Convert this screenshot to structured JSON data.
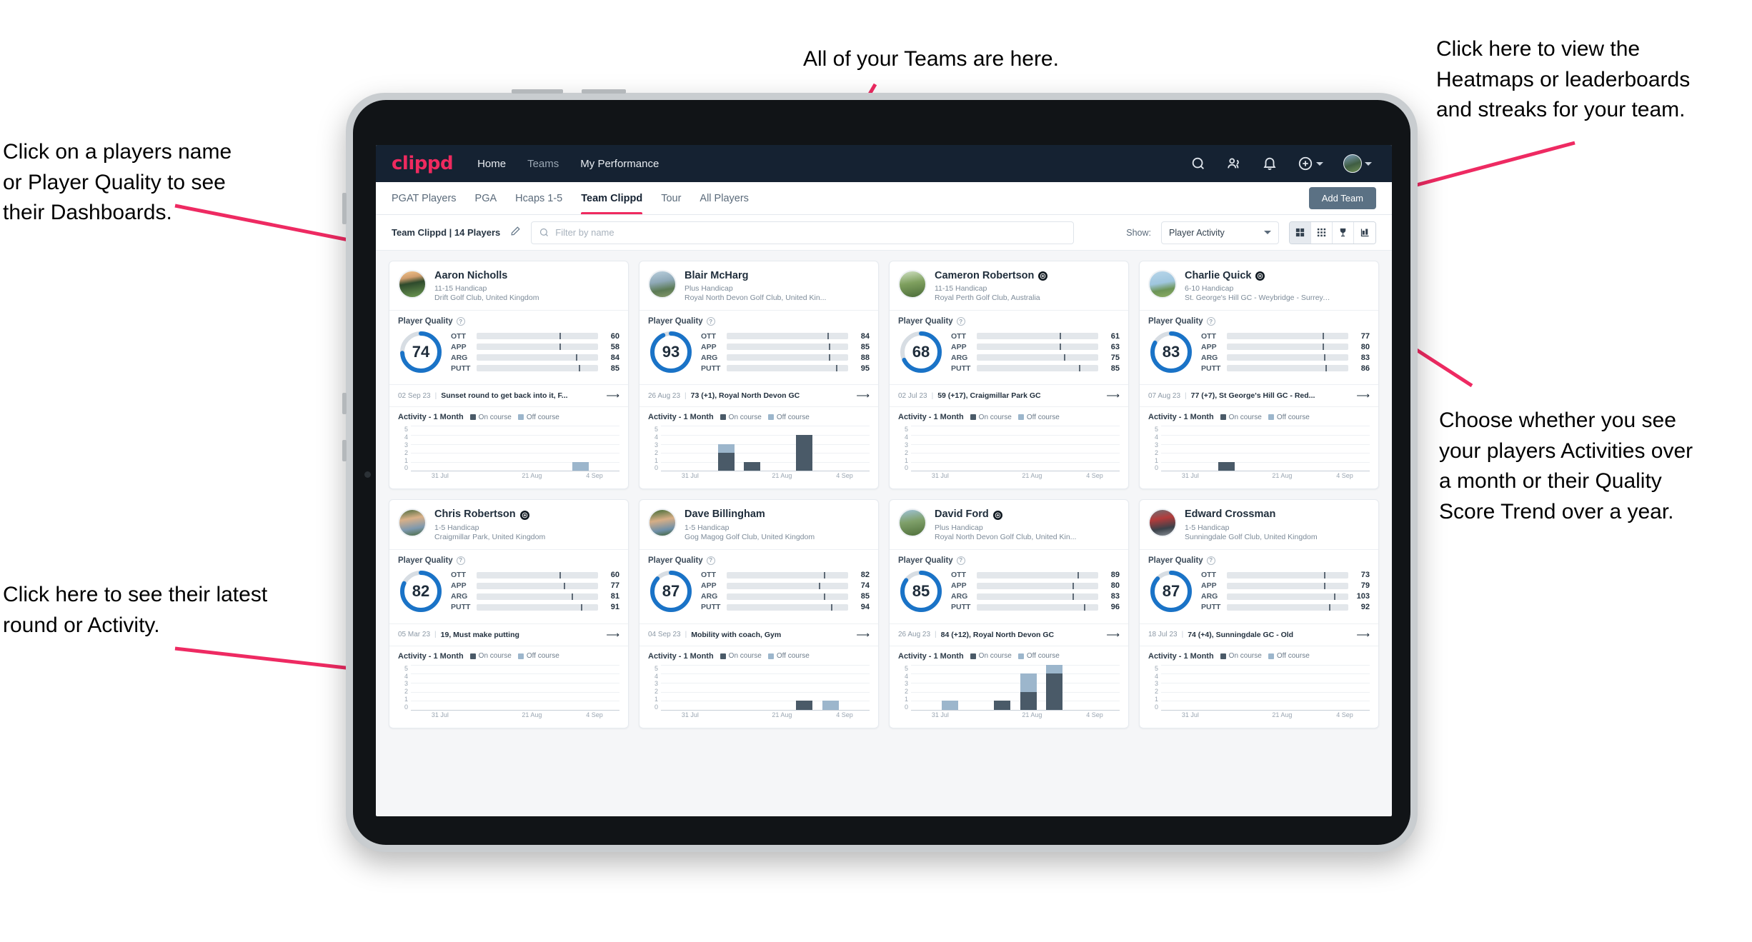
{
  "annotations": [
    {
      "id": "teams",
      "text": "All of your Teams are here."
    },
    {
      "id": "heatmaps",
      "text": "Click here to view the\nHeatmaps or leaderboards\nand streaks for your team."
    },
    {
      "id": "players-name",
      "text": "Click on a players name\nor Player Quality to see\ntheir Dashboards."
    },
    {
      "id": "activity-choice",
      "text": "Choose whether you see\nyour players Activities over\na month or their Quality\nScore Trend over a year."
    },
    {
      "id": "latest-round",
      "text": "Click here to see their latest\nround or Activity."
    }
  ],
  "topnav": {
    "logo": "clippd",
    "links": [
      {
        "label": "Home",
        "active": true
      },
      {
        "label": "Teams",
        "active": false
      },
      {
        "label": "My Performance",
        "active": false
      }
    ],
    "icons": [
      "search-icon",
      "people-icon",
      "bell-icon",
      "plus-circle-icon",
      "avatar"
    ]
  },
  "tabs": [
    {
      "label": "PGAT Players",
      "active": false
    },
    {
      "label": "PGA",
      "active": false
    },
    {
      "label": "Hcaps 1-5",
      "active": false
    },
    {
      "label": "Team Clippd",
      "active": true
    },
    {
      "label": "Tour",
      "active": false
    },
    {
      "label": "All Players",
      "active": false
    }
  ],
  "add_team_label": "Add Team",
  "toolbar": {
    "team_label": "Team Clippd | 14 Players",
    "edit_icon": "pencil-icon",
    "search_placeholder": "Filter by name",
    "search_value": "",
    "show_label": "Show:",
    "show_value": "Player Activity",
    "views": [
      {
        "name": "grid-large-view",
        "active": true
      },
      {
        "name": "grid-small-view",
        "active": false
      },
      {
        "name": "trophy-view",
        "active": false
      },
      {
        "name": "stats-view",
        "active": false
      }
    ]
  },
  "card_labels": {
    "player_quality": "Player Quality",
    "activity": "Activity - 1 Month",
    "legend_on": "On course",
    "legend_off": "Off course",
    "metrics": [
      "OTT",
      "APP",
      "ARG",
      "PUTT"
    ]
  },
  "metric_colors": {
    "OTT": "#f5b400",
    "APP": "#2ecfa0",
    "ARG": "#f5124f",
    "PUTT": "#aa00cc",
    "ring": "#1a73c7",
    "ring_track": "#d7dde3"
  },
  "chart_data": {
    "type": "bar",
    "title": "Activity - 1 Month",
    "xlabel": "",
    "ylabel": "",
    "ylim": [
      0,
      5
    ],
    "yticks": [
      0,
      1,
      2,
      3,
      4,
      5
    ],
    "xticks": [
      "31 Jul",
      "21 Aug",
      "4 Sep"
    ],
    "grid": true,
    "legend": [
      "On course",
      "Off course"
    ],
    "legend_position": "top",
    "panels": [
      {
        "player": "Aaron Nicholls",
        "series": [
          {
            "name": "On course",
            "values": [
              0,
              0,
              0,
              0,
              0,
              0,
              0,
              0
            ]
          },
          {
            "name": "Off course",
            "values": [
              0,
              0,
              0,
              0,
              0,
              0,
              1,
              0
            ]
          }
        ]
      },
      {
        "player": "Blair McHarg",
        "series": [
          {
            "name": "On course",
            "values": [
              0,
              0,
              2,
              1,
              0,
              4,
              0,
              0
            ]
          },
          {
            "name": "Off course",
            "values": [
              0,
              0,
              1,
              0,
              0,
              0,
              0,
              0
            ]
          }
        ]
      },
      {
        "player": "Cameron Robertson",
        "series": [
          {
            "name": "On course",
            "values": [
              0,
              0,
              0,
              0,
              0,
              0,
              0,
              0
            ]
          },
          {
            "name": "Off course",
            "values": [
              0,
              0,
              0,
              0,
              0,
              0,
              0,
              0
            ]
          }
        ]
      },
      {
        "player": "Charlie Quick",
        "series": [
          {
            "name": "On course",
            "values": [
              0,
              0,
              1,
              0,
              0,
              0,
              0,
              0
            ]
          },
          {
            "name": "Off course",
            "values": [
              0,
              0,
              0,
              0,
              0,
              0,
              0,
              0
            ]
          }
        ]
      },
      {
        "player": "Chris Robertson",
        "series": [
          {
            "name": "On course",
            "values": [
              0,
              0,
              0,
              0,
              0,
              0,
              0,
              0
            ]
          },
          {
            "name": "Off course",
            "values": [
              0,
              0,
              0,
              0,
              0,
              0,
              0,
              0
            ]
          }
        ]
      },
      {
        "player": "Dave Billingham",
        "series": [
          {
            "name": "On course",
            "values": [
              0,
              0,
              0,
              0,
              0,
              0,
              1,
              0
            ]
          },
          {
            "name": "Off course",
            "values": [
              0,
              0,
              0,
              0,
              0,
              0,
              0,
              1
            ]
          }
        ]
      },
      {
        "player": "David Ford",
        "series": [
          {
            "name": "On course",
            "values": [
              0,
              0,
              0,
              1,
              2,
              4,
              0,
              0
            ]
          },
          {
            "name": "Off course",
            "values": [
              0,
              1,
              0,
              0,
              2,
              1,
              0,
              0
            ]
          }
        ]
      },
      {
        "player": "Edward Crossman",
        "series": [
          {
            "name": "On course",
            "values": [
              0,
              0,
              0,
              0,
              0,
              0,
              0,
              0
            ]
          },
          {
            "name": "Off course",
            "values": [
              0,
              0,
              0,
              0,
              0,
              0,
              0,
              0
            ]
          }
        ]
      }
    ]
  },
  "players": [
    {
      "name": "Aaron Nicholls",
      "verified": false,
      "handicap": "11-15 Handicap",
      "club": "Drift Golf Club, United Kingdom",
      "quality": 74,
      "metrics": [
        {
          "key": "OTT",
          "value": 60,
          "fill": 52,
          "tick": 68
        },
        {
          "key": "APP",
          "value": 58,
          "fill": 50,
          "tick": 68
        },
        {
          "key": "ARG",
          "value": 84,
          "fill": 76,
          "tick": 82
        },
        {
          "key": "PUTT",
          "value": 85,
          "fill": 78,
          "tick": 84
        }
      ],
      "round_date": "02 Sep 23",
      "round_text": "Sunset round to get back into it, F..."
    },
    {
      "name": "Blair McHarg",
      "verified": false,
      "handicap": "Plus Handicap",
      "club": "Royal North Devon Golf Club, United Kin...",
      "quality": 93,
      "metrics": [
        {
          "key": "OTT",
          "value": 84,
          "fill": 78,
          "tick": 83
        },
        {
          "key": "APP",
          "value": 85,
          "fill": 79,
          "tick": 84
        },
        {
          "key": "ARG",
          "value": 88,
          "fill": 80,
          "tick": 84
        },
        {
          "key": "PUTT",
          "value": 95,
          "fill": 86,
          "tick": 90
        }
      ],
      "round_date": "26 Aug 23",
      "round_text": "73 (+1), Royal North Devon GC"
    },
    {
      "name": "Cameron Robertson",
      "verified": true,
      "handicap": "11-15 Handicap",
      "club": "Royal Perth Golf Club, Australia",
      "quality": 68,
      "metrics": [
        {
          "key": "OTT",
          "value": 61,
          "fill": 52,
          "tick": 68
        },
        {
          "key": "APP",
          "value": 63,
          "fill": 54,
          "tick": 68
        },
        {
          "key": "ARG",
          "value": 75,
          "fill": 64,
          "tick": 72
        },
        {
          "key": "PUTT",
          "value": 85,
          "fill": 78,
          "tick": 84
        }
      ],
      "round_date": "02 Jul 23",
      "round_text": "59 (+17), Craigmillar Park GC"
    },
    {
      "name": "Charlie Quick",
      "verified": true,
      "handicap": "6-10 Handicap",
      "club": "St. George's Hill GC - Weybridge - Surrey, ...",
      "quality": 83,
      "metrics": [
        {
          "key": "OTT",
          "value": 77,
          "fill": 67,
          "tick": 79
        },
        {
          "key": "APP",
          "value": 80,
          "fill": 70,
          "tick": 79
        },
        {
          "key": "ARG",
          "value": 83,
          "fill": 72,
          "tick": 80
        },
        {
          "key": "PUTT",
          "value": 86,
          "fill": 75,
          "tick": 81
        }
      ],
      "round_date": "07 Aug 23",
      "round_text": "77 (+7), St George's Hill GC - Red..."
    },
    {
      "name": "Chris Robertson",
      "verified": true,
      "handicap": "1-5 Handicap",
      "club": "Craigmillar Park, United Kingdom",
      "quality": 82,
      "metrics": [
        {
          "key": "OTT",
          "value": 60,
          "fill": 52,
          "tick": 68
        },
        {
          "key": "APP",
          "value": 77,
          "fill": 66,
          "tick": 72
        },
        {
          "key": "ARG",
          "value": 81,
          "fill": 70,
          "tick": 78
        },
        {
          "key": "PUTT",
          "value": 91,
          "fill": 81,
          "tick": 86
        }
      ],
      "round_date": "05 Mar 23",
      "round_text": "19, Must make putting"
    },
    {
      "name": "Dave Billingham",
      "verified": false,
      "handicap": "1-5 Handicap",
      "club": "Gog Magog Golf Club, United Kingdom",
      "quality": 87,
      "metrics": [
        {
          "key": "OTT",
          "value": 82,
          "fill": 72,
          "tick": 80
        },
        {
          "key": "APP",
          "value": 74,
          "fill": 63,
          "tick": 76
        },
        {
          "key": "ARG",
          "value": 85,
          "fill": 74,
          "tick": 80
        },
        {
          "key": "PUTT",
          "value": 94,
          "fill": 83,
          "tick": 86
        }
      ],
      "round_date": "04 Sep 23",
      "round_text": "Mobility with coach, Gym"
    },
    {
      "name": "David Ford",
      "verified": true,
      "handicap": "Plus Handicap",
      "club": "Royal North Devon Golf Club, United Kin...",
      "quality": 85,
      "metrics": [
        {
          "key": "OTT",
          "value": 89,
          "fill": 78,
          "tick": 83
        },
        {
          "key": "APP",
          "value": 80,
          "fill": 68,
          "tick": 79
        },
        {
          "key": "ARG",
          "value": 83,
          "fill": 71,
          "tick": 79
        },
        {
          "key": "PUTT",
          "value": 96,
          "fill": 85,
          "tick": 88
        }
      ],
      "round_date": "26 Aug 23",
      "round_text": "84 (+12), Royal North Devon GC"
    },
    {
      "name": "Edward Crossman",
      "verified": false,
      "handicap": "1-5 Handicap",
      "club": "Sunningdale Golf Club, United Kingdom",
      "quality": 87,
      "metrics": [
        {
          "key": "OTT",
          "value": 73,
          "fill": 62,
          "tick": 80
        },
        {
          "key": "APP",
          "value": 79,
          "fill": 66,
          "tick": 80
        },
        {
          "key": "ARG",
          "value": 103,
          "fill": 82,
          "tick": 88
        },
        {
          "key": "PUTT",
          "value": 92,
          "fill": 78,
          "tick": 84
        }
      ],
      "round_date": "18 Jul 23",
      "round_text": "74 (+4), Sunningdale GC - Old"
    }
  ]
}
